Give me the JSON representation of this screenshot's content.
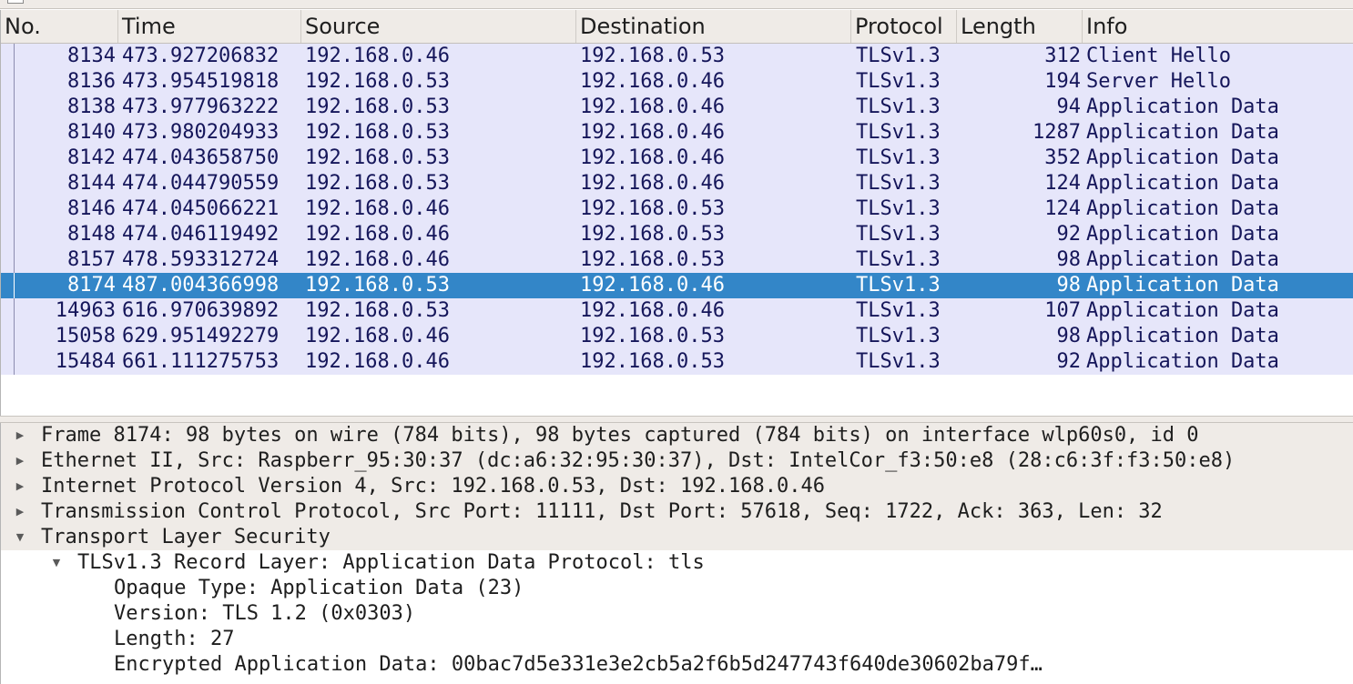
{
  "columns": [
    "No.",
    "Time",
    "Source",
    "Destination",
    "Protocol",
    "Length",
    "Info"
  ],
  "packets": [
    {
      "no": "8134",
      "time": "473.927206832",
      "src": "192.168.0.46",
      "dst": "192.168.0.53",
      "proto": "TLSv1.3",
      "len": "312",
      "info": "Client Hello"
    },
    {
      "no": "8136",
      "time": "473.954519818",
      "src": "192.168.0.53",
      "dst": "192.168.0.46",
      "proto": "TLSv1.3",
      "len": "194",
      "info": "Server Hello"
    },
    {
      "no": "8138",
      "time": "473.977963222",
      "src": "192.168.0.53",
      "dst": "192.168.0.46",
      "proto": "TLSv1.3",
      "len": "94",
      "info": "Application Data"
    },
    {
      "no": "8140",
      "time": "473.980204933",
      "src": "192.168.0.53",
      "dst": "192.168.0.46",
      "proto": "TLSv1.3",
      "len": "1287",
      "info": "Application Data"
    },
    {
      "no": "8142",
      "time": "474.043658750",
      "src": "192.168.0.53",
      "dst": "192.168.0.46",
      "proto": "TLSv1.3",
      "len": "352",
      "info": "Application Data"
    },
    {
      "no": "8144",
      "time": "474.044790559",
      "src": "192.168.0.53",
      "dst": "192.168.0.46",
      "proto": "TLSv1.3",
      "len": "124",
      "info": "Application Data"
    },
    {
      "no": "8146",
      "time": "474.045066221",
      "src": "192.168.0.46",
      "dst": "192.168.0.53",
      "proto": "TLSv1.3",
      "len": "124",
      "info": "Application Data"
    },
    {
      "no": "8148",
      "time": "474.046119492",
      "src": "192.168.0.46",
      "dst": "192.168.0.53",
      "proto": "TLSv1.3",
      "len": "92",
      "info": "Application Data"
    },
    {
      "no": "8157",
      "time": "478.593312724",
      "src": "192.168.0.46",
      "dst": "192.168.0.53",
      "proto": "TLSv1.3",
      "len": "98",
      "info": "Application Data"
    },
    {
      "no": "8174",
      "time": "487.004366998",
      "src": "192.168.0.53",
      "dst": "192.168.0.46",
      "proto": "TLSv1.3",
      "len": "98",
      "info": "Application Data",
      "selected": true
    },
    {
      "no": "14963",
      "time": "616.970639892",
      "src": "192.168.0.53",
      "dst": "192.168.0.46",
      "proto": "TLSv1.3",
      "len": "107",
      "info": "Application Data"
    },
    {
      "no": "15058",
      "time": "629.951492279",
      "src": "192.168.0.46",
      "dst": "192.168.0.53",
      "proto": "TLSv1.3",
      "len": "98",
      "info": "Application Data"
    },
    {
      "no": "15484",
      "time": "661.111275753",
      "src": "192.168.0.46",
      "dst": "192.168.0.53",
      "proto": "TLSv1.3",
      "len": "92",
      "info": "Application Data"
    }
  ],
  "details": [
    {
      "text": "Frame 8174: 98 bytes on wire (784 bits), 98 bytes captured (784 bits) on interface wlp60s0, id 0",
      "level": 0,
      "expander": "collapsed",
      "shaded": true
    },
    {
      "text": "Ethernet II, Src: Raspberr_95:30:37 (dc:a6:32:95:30:37), Dst: IntelCor_f3:50:e8 (28:c6:3f:f3:50:e8)",
      "level": 0,
      "expander": "collapsed",
      "shaded": true
    },
    {
      "text": "Internet Protocol Version 4, Src: 192.168.0.53, Dst: 192.168.0.46",
      "level": 0,
      "expander": "collapsed",
      "shaded": true
    },
    {
      "text": "Transmission Control Protocol, Src Port: 11111, Dst Port: 57618, Seq: 1722, Ack: 363, Len: 32",
      "level": 0,
      "expander": "collapsed",
      "shaded": true
    },
    {
      "text": "Transport Layer Security",
      "level": 0,
      "expander": "expanded",
      "shaded": true
    },
    {
      "text": "TLSv1.3 Record Layer: Application Data Protocol: tls",
      "level": 1,
      "expander": "expanded",
      "shaded": false
    },
    {
      "text": "Opaque Type: Application Data (23)",
      "level": 2,
      "expander": "none",
      "shaded": false
    },
    {
      "text": "Version: TLS 1.2 (0x0303)",
      "level": 2,
      "expander": "none",
      "shaded": false
    },
    {
      "text": "Length: 27",
      "level": 2,
      "expander": "none",
      "shaded": false
    },
    {
      "text": "Encrypted Application Data: 00bac7d5e331e3e2cb5a2f6b5d247743f640de30602ba79f…",
      "level": 2,
      "expander": "none",
      "shaded": false
    }
  ],
  "icons": {
    "collapsed": "triangle-right-icon",
    "expanded": "triangle-down-icon"
  },
  "colors": {
    "row_bg": "#e6e6fa",
    "row_text": "#15165a",
    "selected_bg": "#3386c8",
    "header_bg": "#efebe7"
  }
}
